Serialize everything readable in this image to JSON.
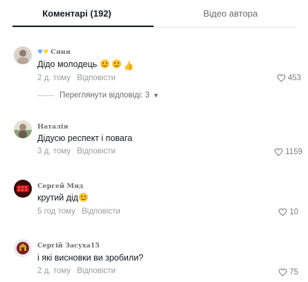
{
  "tabs": {
    "comments_label": "Коментарі (192)",
    "author_videos_label": "Відео автора"
  },
  "comments": [
    {
      "author": "Сяня",
      "text": "Дідо молодець",
      "time": "2 д. тому",
      "reply_label": "Відповісти",
      "likes": "453",
      "view_replies": "Переглянути відповіді: 3"
    },
    {
      "author": "Наталія",
      "text": "Дідусю респект і повага",
      "time": "3 д. тому",
      "reply_label": "Відповісти",
      "likes": "1159"
    },
    {
      "author": "Сергей Мяд",
      "text": "крутий дід",
      "time": "5 год тому",
      "reply_label": "Відповісти",
      "likes": "10"
    },
    {
      "author": "Сергій Засуха15",
      "text": "і які висновки ви зробили?",
      "time": "2 д. тому",
      "reply_label": "Відповісти",
      "likes": "75"
    }
  ],
  "colors": {
    "text": "#161823",
    "muted": "#9a9a9a",
    "heart_blue": "#6ea8ff",
    "heart_yellow": "#ffd43b"
  }
}
